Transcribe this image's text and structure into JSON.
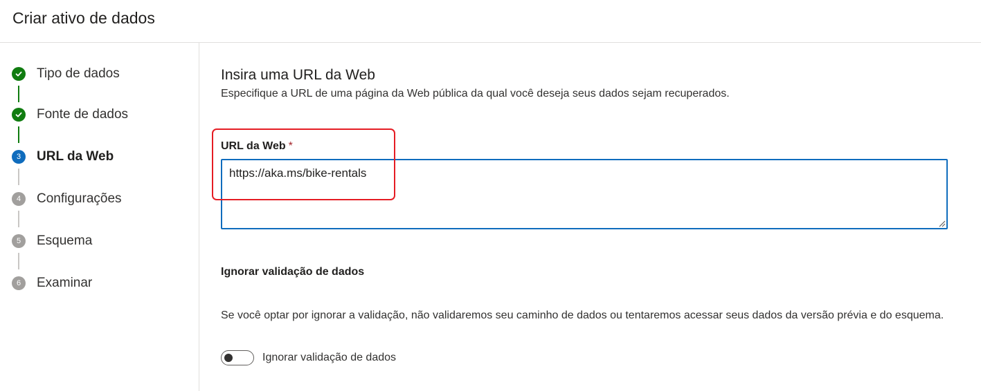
{
  "header": {
    "title": "Criar ativo de dados"
  },
  "steps": [
    {
      "label": "Tipo de dados",
      "status": "done",
      "icon": "check-icon"
    },
    {
      "label": "Fonte de dados",
      "status": "done",
      "icon": "check-icon"
    },
    {
      "label": "URL da Web",
      "status": "current",
      "number": "3"
    },
    {
      "label": "Configurações",
      "status": "pending",
      "number": "4"
    },
    {
      "label": "Esquema",
      "status": "pending",
      "number": "5"
    },
    {
      "label": "Examinar",
      "status": "pending",
      "number": "6"
    }
  ],
  "main": {
    "title": "Insira uma URL da Web",
    "description": "Especifique a URL de uma página da Web pública da qual você deseja seus dados sejam recuperados.",
    "url_field": {
      "label": "URL da Web",
      "required_mark": "*",
      "value": "https://aka.ms/bike-rentals"
    },
    "skip_validation": {
      "title": "Ignorar validação de dados",
      "description": "Se você optar por ignorar a validação, não validaremos seu caminho de dados ou tentaremos acessar seus dados da versão prévia e do esquema.",
      "toggle_label": "Ignorar validação de dados",
      "toggle_on": false
    }
  },
  "colors": {
    "done": "#107c10",
    "current": "#0f6cbd",
    "pending": "#a19f9d",
    "highlight": "#e51c23",
    "required": "#a4262c"
  }
}
